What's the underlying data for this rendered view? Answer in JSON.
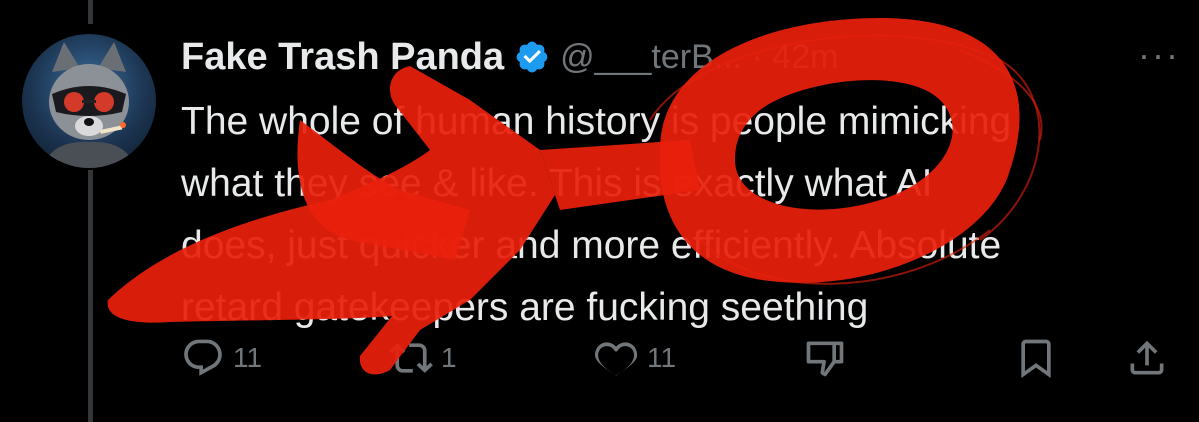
{
  "author": {
    "display_name": "Fake Trash Panda",
    "handle_timestamp": "@___terB... · 42m",
    "verified": true
  },
  "tweet": {
    "lines": [
      "The whole of human history is people mimicking",
      "what they see & like. This is exactly what AI",
      "does, just quicker and more efficiently. Absolute",
      "retard gatekeepers are fucking seething"
    ]
  },
  "actions": {
    "reply_count": "11",
    "repost_count": "1",
    "like_count": "11"
  },
  "icons": {
    "more": "more-options-icon",
    "reply": "reply-icon",
    "repost": "repost-icon",
    "like": "heart-icon",
    "dislike": "thumbs-down-icon",
    "bookmark": "bookmark-icon",
    "share": "share-icon"
  },
  "colors": {
    "background": "#000000",
    "text": "#e7e9ea",
    "muted": "#71767b",
    "verified": "#1d9bf0",
    "scribble": "#e8200c"
  }
}
